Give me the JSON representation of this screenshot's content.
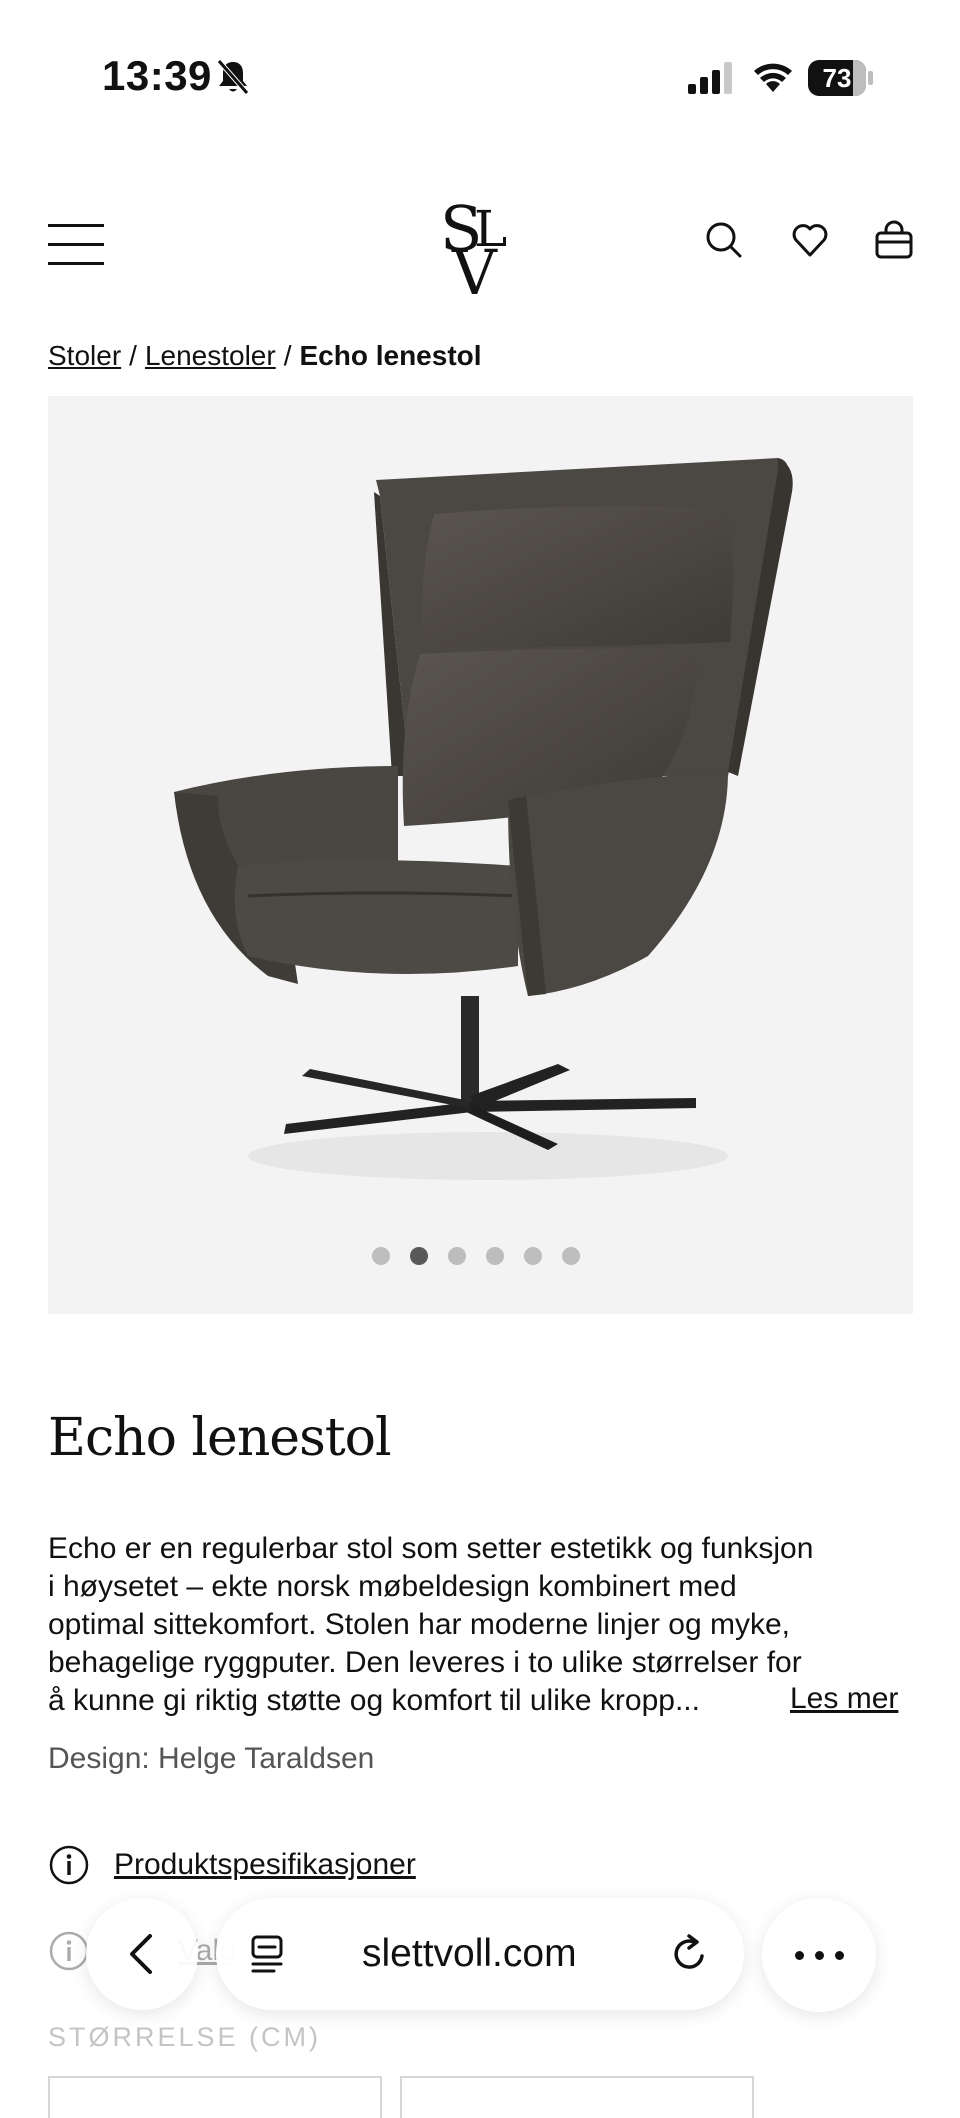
{
  "status_bar": {
    "time": "13:39",
    "battery": "73",
    "battery_level_percent": 73
  },
  "header": {
    "logo_letters": [
      "S",
      "L",
      "V"
    ],
    "icons": [
      "menu-icon",
      "search-icon",
      "heart-icon",
      "bag-icon"
    ]
  },
  "breadcrumb": {
    "items": [
      {
        "label": "Stoler"
      },
      {
        "label": "Lenestoler"
      }
    ],
    "separator": "/",
    "current": "Echo lenestol"
  },
  "gallery": {
    "slide_count": 6,
    "active_slide": 2
  },
  "product": {
    "title": "Echo lenestol",
    "description_lines": [
      "Echo er en regulerbar stol som setter estetikk og funksjon",
      "i høysetet – ekte norsk møbeldesign kombinert med",
      "optimal sittekomfort. Stolen har moderne linjer og myke,",
      "behagelige ryggputer. Den leveres i to ulike størrelser for",
      "å kunne gi riktig støtte og komfort til ulike kropp..."
    ],
    "read_more": "Les mer",
    "designer": "Design: Helge Taraldsen",
    "spec_link": "Produktspesifikasjoner",
    "second_link_partial": "Valg",
    "size_heading": "STØRRELSE (CM)"
  },
  "browser": {
    "url": "slettvoll.com"
  }
}
